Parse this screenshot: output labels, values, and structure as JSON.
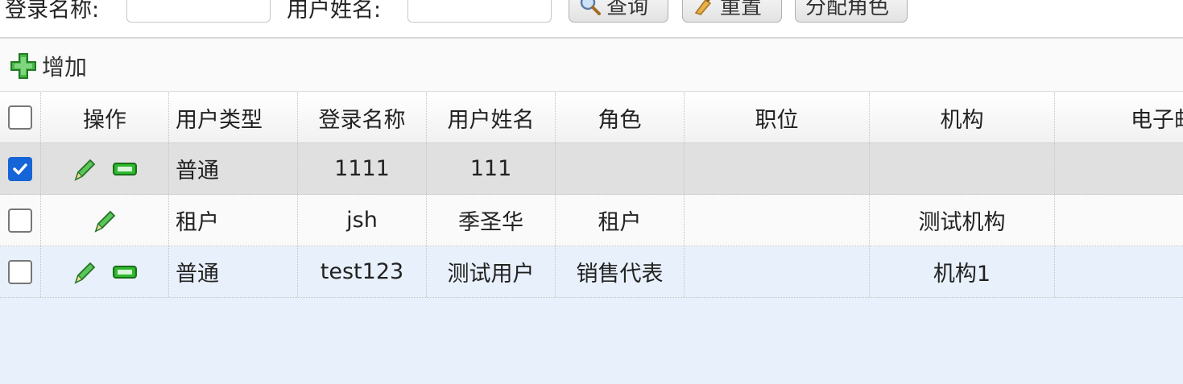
{
  "search": {
    "login_label": "登录名称:",
    "login_value": "",
    "name_label": "用户姓名:",
    "name_value": "",
    "query_label": "查询",
    "reset_label": "重置",
    "assign_label": "分配角色"
  },
  "toolbar": {
    "add_label": "增加"
  },
  "table": {
    "columns": [
      "操作",
      "用户类型",
      "登录名称",
      "用户姓名",
      "角色",
      "职位",
      "机构",
      "电子邮"
    ],
    "rows": [
      {
        "checked": true,
        "type": "普通",
        "login": "1111",
        "name": "111",
        "role": "",
        "position": "",
        "org": "",
        "email": "",
        "has_delete": true
      },
      {
        "checked": false,
        "type": "租户",
        "login": "jsh",
        "name": "季圣华",
        "role": "租户",
        "position": "",
        "org": "测试机构",
        "email": "",
        "has_delete": false
      },
      {
        "checked": false,
        "type": "普通",
        "login": "test123",
        "name": "测试用户",
        "role": "销售代表",
        "position": "",
        "org": "机构1",
        "email": "",
        "has_delete": true
      }
    ]
  },
  "colors": {
    "accent": "#1565d8",
    "selected_row": "#e0e0e0",
    "alt_row": "#e8f0fb",
    "edit_icon": "#3aa53a",
    "delete_icon": "#22a322"
  },
  "icons": {
    "query": "search-icon",
    "reset": "broom-icon",
    "add": "green-plus-icon",
    "edit": "pencil-icon",
    "delete": "minus-icon"
  }
}
